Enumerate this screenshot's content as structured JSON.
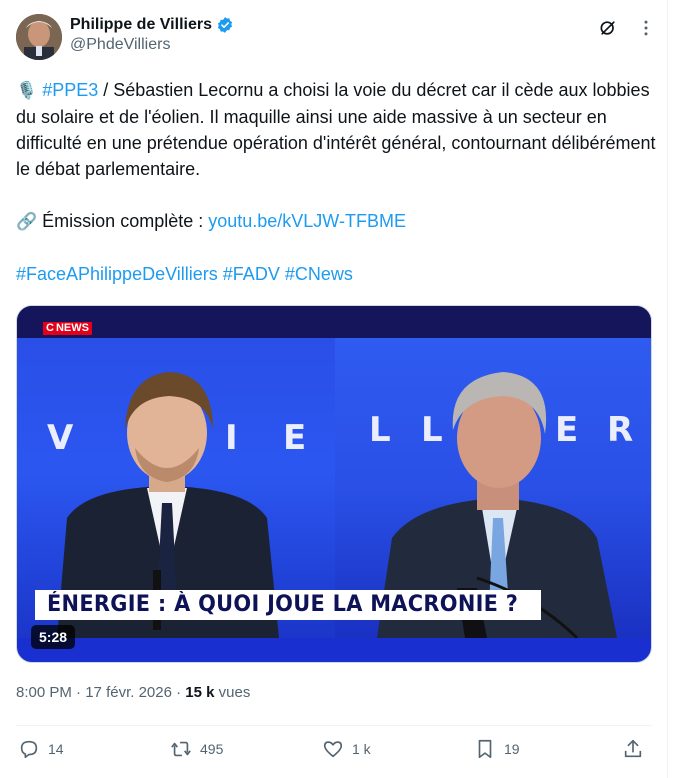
{
  "author": {
    "display_name": "Philippe de Villiers",
    "handle": "@PhdeVilliers"
  },
  "header_icons": [
    "grok-icon",
    "more-icon"
  ],
  "tweet": {
    "hashtag_ppe3": "#PPE3",
    "line1_rest": " / Sébastien Lecornu a choisi la voie du décret car il cède aux lobbies du solaire et de l'éolien. Il maquille ainsi une aide massive à un secteur en difficulté en une prétendue opération d'intérêt général, contournant délibérément le débat parlementaire.",
    "emission_label": " Émission complète : ",
    "emission_link": "youtu.be/kVLJW-TFBME",
    "hashtags": [
      "#FaceAPhilippeDeVilliers",
      "#FADV",
      "#CNews"
    ]
  },
  "media": {
    "channel": "NEWS",
    "banner": "ÉNERGIE : À QUOI JOUE LA MACRONIE ?",
    "duration": "5:28",
    "wall_left": [
      "V",
      "I",
      "E"
    ],
    "wall_right": [
      "L",
      "L",
      "E",
      "R"
    ]
  },
  "meta": {
    "time": "8:00 PM",
    "separator": " · ",
    "date": "17 févr. 2026",
    "views_count": "15 k",
    "views_label": " vues"
  },
  "actions": {
    "replies": "14",
    "reposts": "495",
    "likes": "1 k",
    "bookmarks": "19"
  },
  "colors": {
    "link": "#1d9bf0",
    "verified": "#1d9bf0",
    "secondary_text": "#536471",
    "banner_text": "#0e1257",
    "cnews_red": "#e2001a"
  }
}
